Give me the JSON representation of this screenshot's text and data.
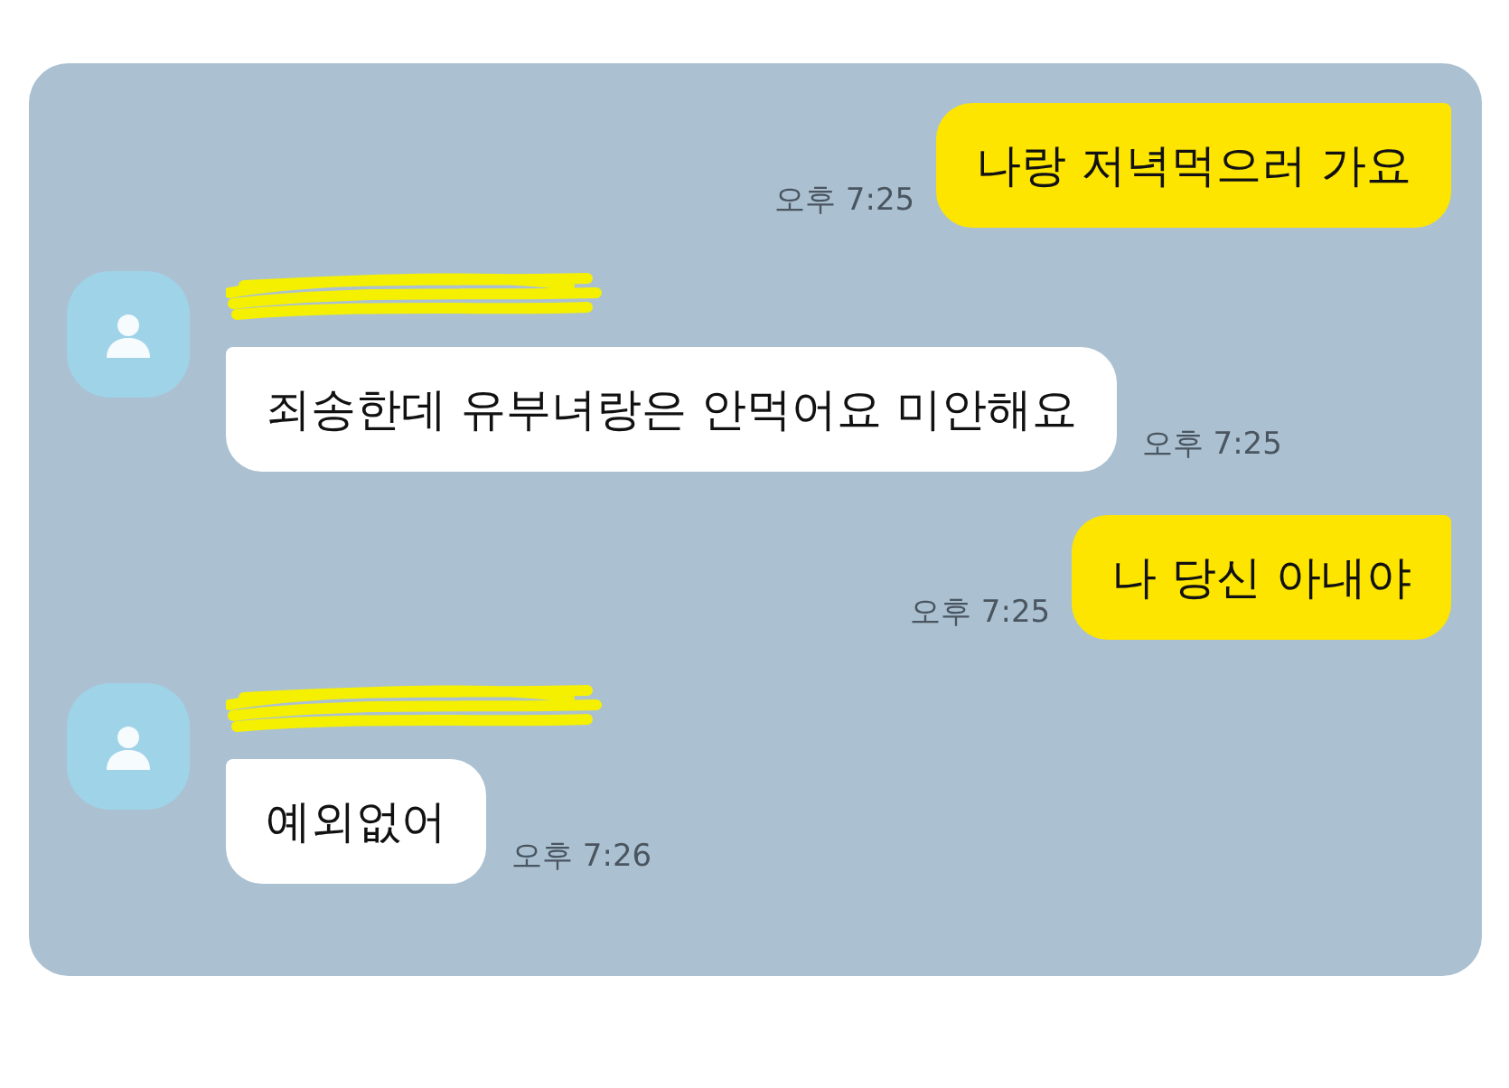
{
  "messages": [
    {
      "kind": "outgoing",
      "text": "나랑 저녁먹으러 가요",
      "time": "오후 7:25"
    },
    {
      "kind": "incoming",
      "sender_redacted": true,
      "text": "죄송한데 유부녀랑은 안먹어요 미안해요",
      "time": "오후 7:25"
    },
    {
      "kind": "outgoing",
      "text": "나 당신 아내야",
      "time": "오후 7:25"
    },
    {
      "kind": "incoming",
      "sender_redacted": true,
      "text": "예외없어",
      "time": "오후 7:26"
    }
  ]
}
